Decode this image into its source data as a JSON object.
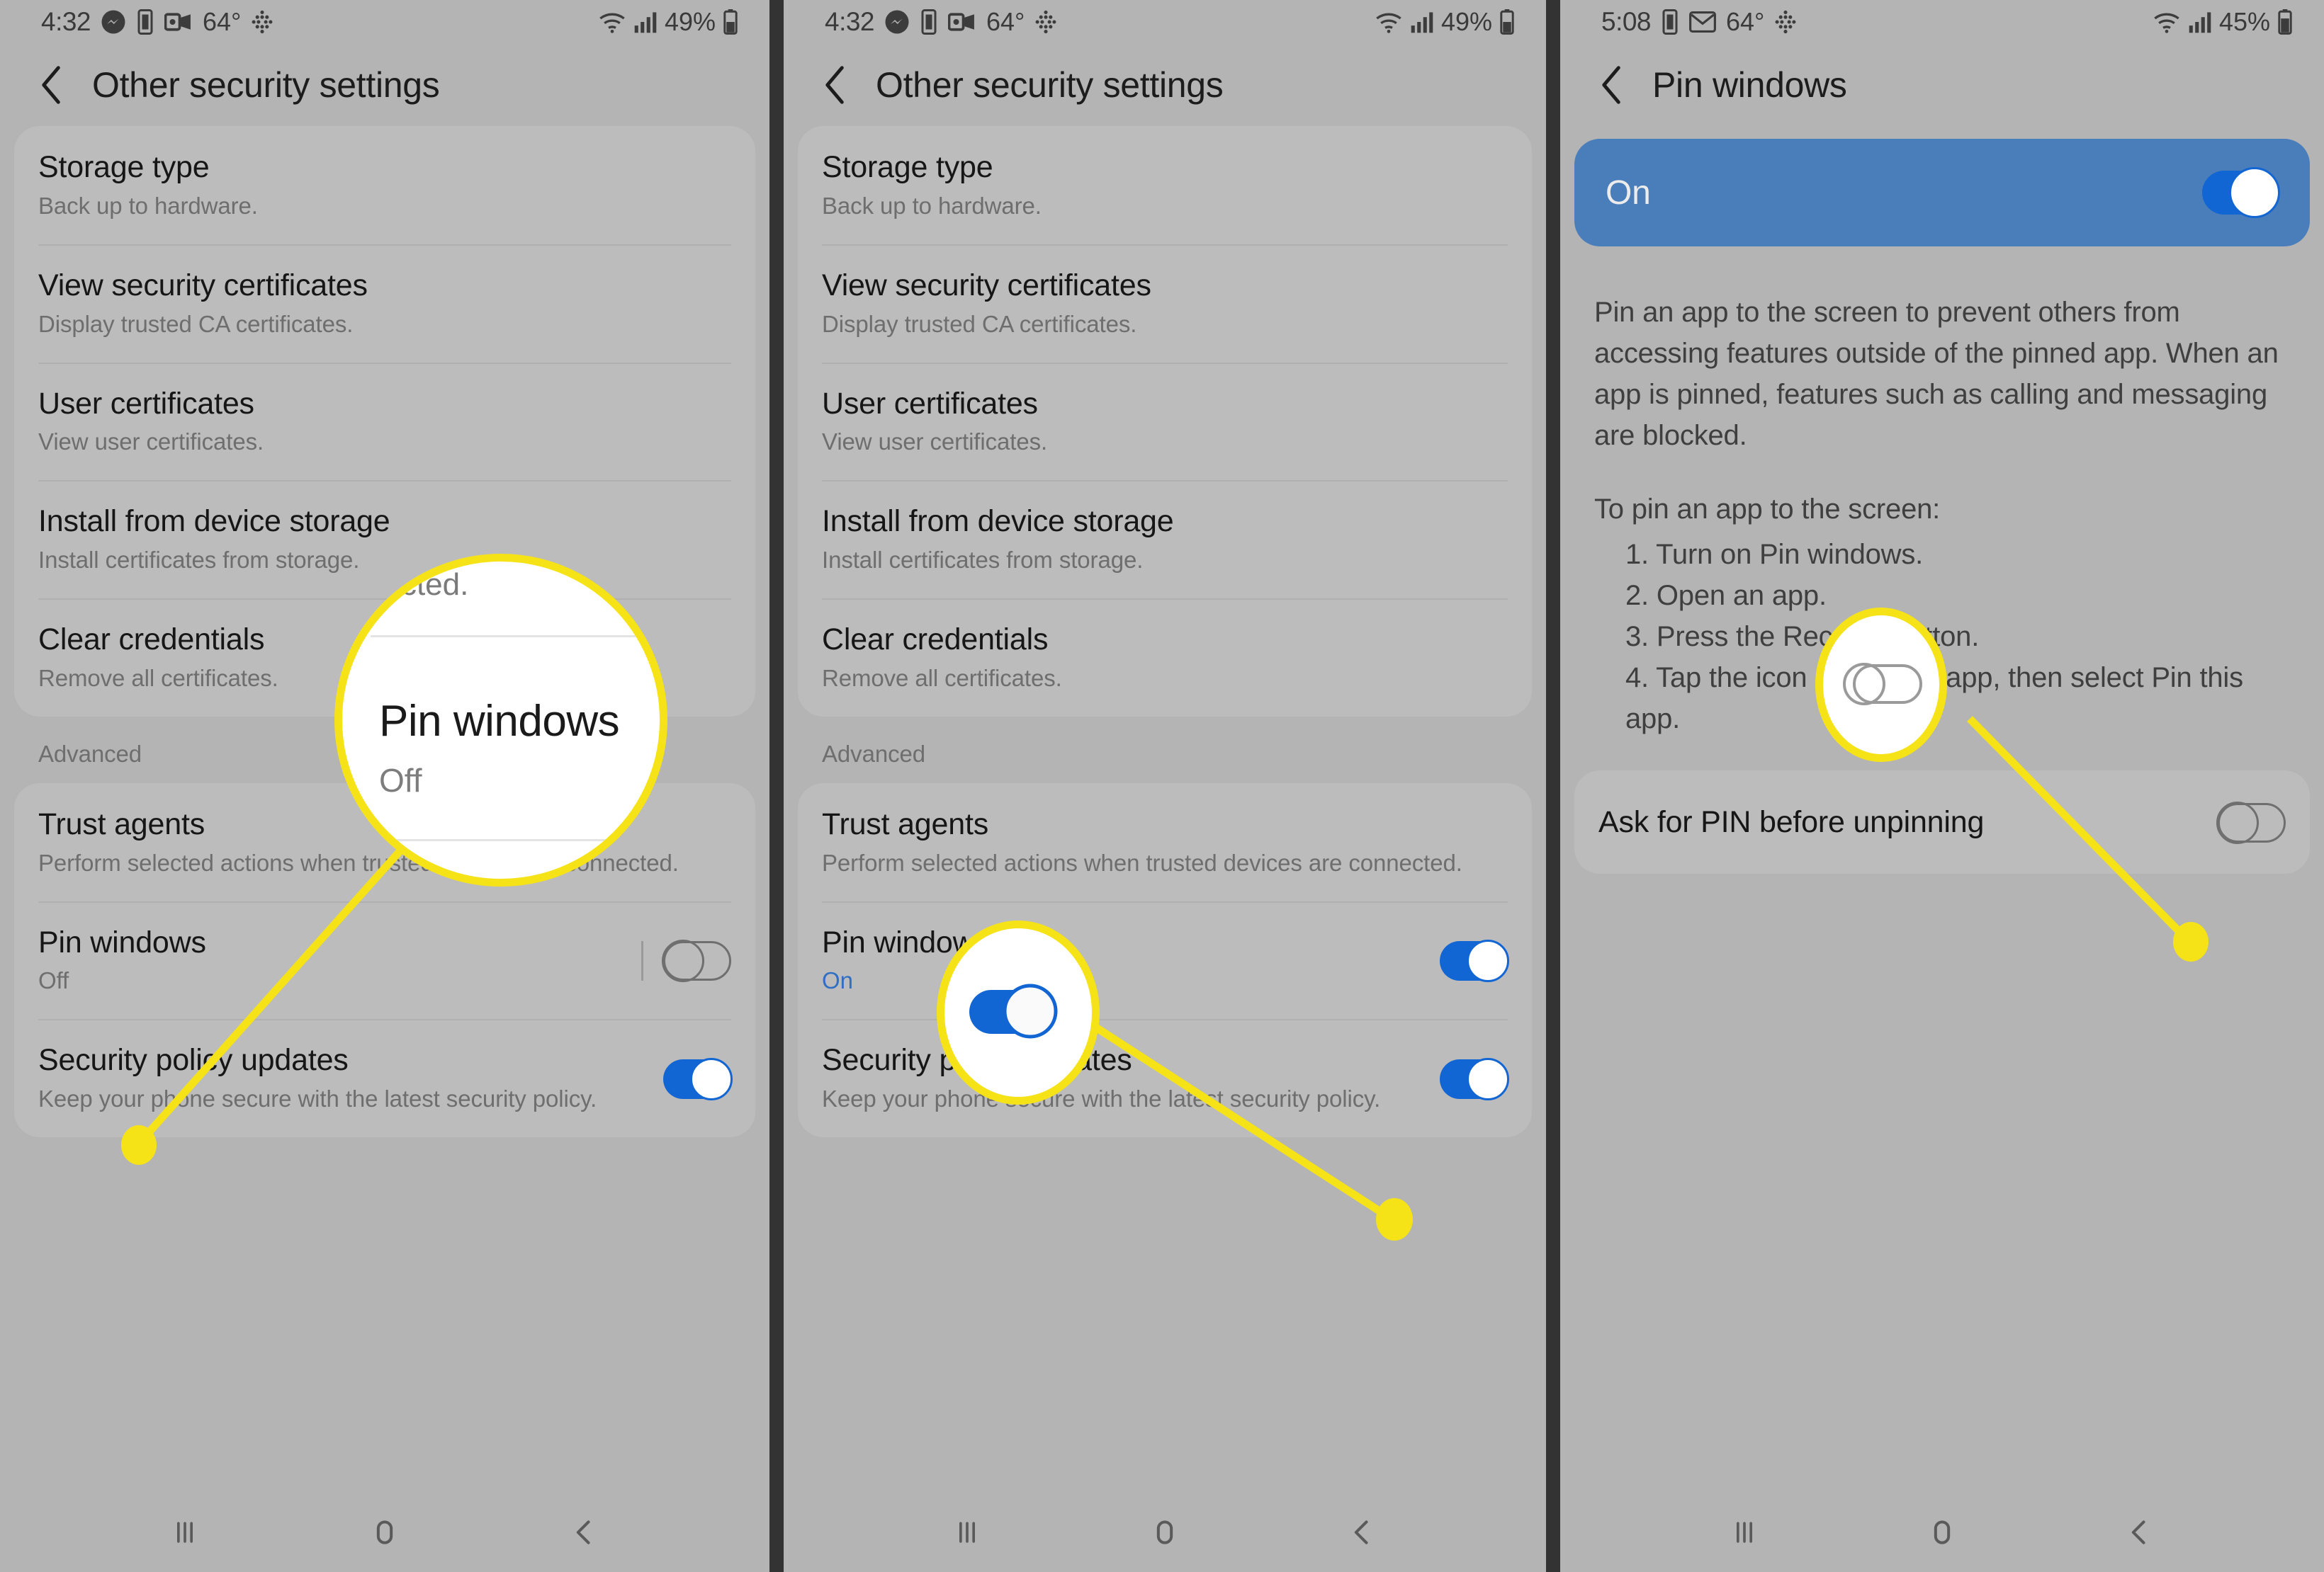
{
  "screens": [
    {
      "id": "screen-1",
      "status": {
        "time": "4:32",
        "battery": "49%",
        "temperature": "64°",
        "icons": [
          "messenger-icon",
          "glass-icon",
          "outlook-icon",
          "dots-icon"
        ],
        "right_icons": [
          "wifi-icon",
          "signal-icon",
          "battery-icon"
        ]
      },
      "app_bar": {
        "back": "back-chevron-icon",
        "title": "Other security settings"
      },
      "cards": [
        {
          "rows": [
            {
              "title": "Storage type",
              "sub": "Back up to hardware.",
              "toggle": null
            },
            {
              "title": "View security certificates",
              "sub": "Display trusted CA certificates.",
              "toggle": null
            },
            {
              "title": "User certificates",
              "sub": "View user certificates.",
              "toggle": null
            },
            {
              "title": "Install from device storage",
              "sub": "Install certificates from storage.",
              "toggle": null
            },
            {
              "title": "Clear credentials",
              "sub": "Remove all certificates.",
              "toggle": null
            }
          ]
        }
      ],
      "section_label": "Advanced",
      "advanced_rows": [
        {
          "title": "Trust agents",
          "sub": "Perform selected actions when trusted devices are connected.",
          "toggle": null
        },
        {
          "title": "Pin windows",
          "sub": "Off",
          "sub_accent": false,
          "toggle": "off",
          "divider": true
        },
        {
          "title": "Security policy updates",
          "sub": "Keep your phone secure with the latest security policy.",
          "toggle": "on"
        }
      ]
    },
    {
      "id": "screen-2",
      "status": {
        "time": "4:32",
        "battery": "49%",
        "temperature": "64°",
        "icons": [
          "messenger-icon",
          "glass-icon",
          "outlook-icon",
          "dots-icon"
        ],
        "right_icons": [
          "wifi-icon",
          "signal-icon",
          "battery-icon"
        ]
      },
      "app_bar": {
        "back": "back-chevron-icon",
        "title": "Other security settings"
      },
      "cards": [
        {
          "rows": [
            {
              "title": "Storage type",
              "sub": "Back up to hardware.",
              "toggle": null
            },
            {
              "title": "View security certificates",
              "sub": "Display trusted CA certificates.",
              "toggle": null
            },
            {
              "title": "User certificates",
              "sub": "View user certificates.",
              "toggle": null
            },
            {
              "title": "Install from device storage",
              "sub": "Install certificates from storage.",
              "toggle": null
            },
            {
              "title": "Clear credentials",
              "sub": "Remove all certificates.",
              "toggle": null
            }
          ]
        }
      ],
      "section_label": "Advanced",
      "advanced_rows": [
        {
          "title": "Trust agents",
          "sub": "Perform selected actions when trusted devices are connected.",
          "toggle": null
        },
        {
          "title": "Pin windows",
          "sub": "On",
          "sub_accent": true,
          "toggle": "on",
          "divider": false
        },
        {
          "title": "Security policy updates",
          "sub": "Keep your phone secure with the latest security policy.",
          "toggle": "on"
        }
      ]
    },
    {
      "id": "screen-3",
      "status": {
        "time": "5:08",
        "battery": "45%",
        "temperature": "64°",
        "icons": [
          "glass-icon",
          "gmail-icon",
          "dots-icon"
        ],
        "right_icons": [
          "wifi-icon",
          "signal-icon",
          "battery-icon"
        ]
      },
      "app_bar": {
        "back": "back-chevron-icon",
        "title": "Pin windows"
      },
      "banner": {
        "label": "On",
        "toggle": "on"
      },
      "description": {
        "paragraph1": "Pin an app to the screen to prevent others from accessing features outside of the pinned app. When an app is pinned, features such as calling and messaging are blocked.",
        "paragraph2": "To pin an app to the screen:",
        "steps": [
          "1. Turn on Pin windows.",
          "2. Open an app.",
          "3. Press the Recents button.",
          "4. Tap the icon above the app, then select Pin this app."
        ]
      },
      "setting_row": {
        "title": "Ask for PIN before unpinning",
        "toggle": "off"
      }
    }
  ],
  "nav_bar": {
    "recents": "recents-icon",
    "home": "home-icon",
    "back": "back-icon"
  },
  "annotations": {
    "highlight_color": "#f5e318",
    "callout_1": {
      "top_text": "nected.",
      "title": "Pin windows",
      "sub": "Off"
    },
    "callout_2": {
      "toggle_state": "on"
    },
    "callout_3": {
      "toggle_state": "off"
    }
  }
}
